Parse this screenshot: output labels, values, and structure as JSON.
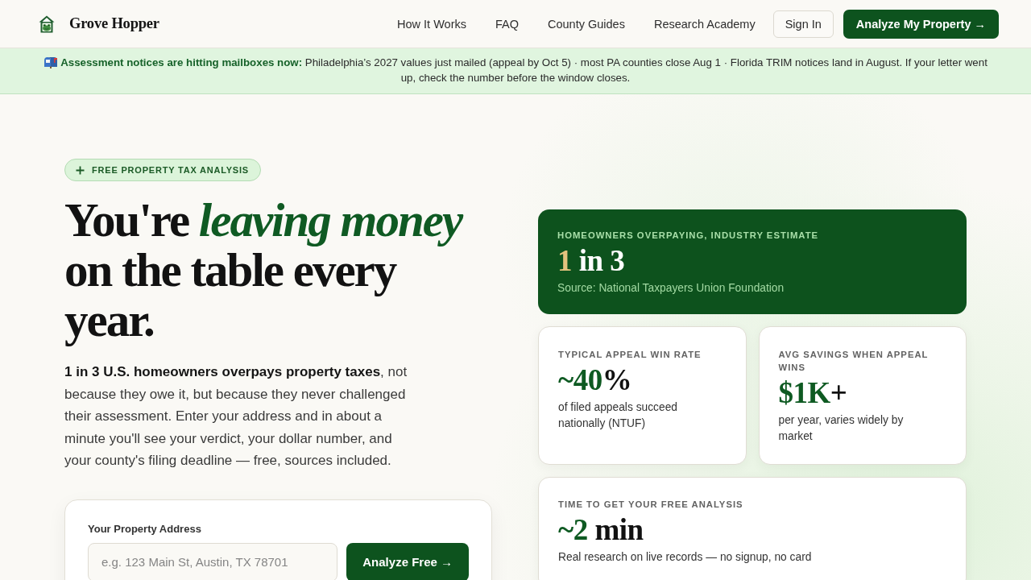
{
  "header": {
    "brand": "Grove Hopper",
    "nav": [
      "How It Works",
      "FAQ",
      "County Guides",
      "Research Academy"
    ],
    "sign_in": "Sign In",
    "cta": "Analyze My Property →"
  },
  "notice": "**Assessment notices are hitting mailboxes now:** Philadelphia’s 2027 values just mailed (appeal by Oct 5) · most PA counties close Aug 1 · Florida TRIM notices land in August. If your letter went up, check the number before the window closes.",
  "hero": {
    "badge": "FREE PROPERTY TAX ANALYSIS",
    "headline": "You're *leaving money* on the table every year.",
    "intro": "**1 in 3 U.S. homeowners overpays property taxes**, not because they owe it, but because they never challenged their assessment. Enter your address and in about a minute you'll see your verdict, your dollar number, and your county's filing deadline — free, sources included.",
    "address_form": {
      "label": "Your Property Address",
      "placeholder": "e.g. 123 Main St, Austin, TX 78701",
      "button": "Analyze Free →"
    }
  },
  "stats": [
    {
      "kind": "featured",
      "label": "HOMEOWNERS OVERPAYING, INDUSTRY ESTIMATE",
      "value": "**1** in 3",
      "note": "Source: National Taxpayers Union Foundation"
    },
    {
      "kind": "half",
      "label": "TYPICAL APPEAL WIN RATE",
      "value": "**~40**%",
      "note": "of filed appeals succeed nationally (NTUF)"
    },
    {
      "kind": "half",
      "label": "AVG SAVINGS WHEN APPEAL WINS",
      "value": "**$1K**+",
      "note": "per year, varies widely by market"
    },
    {
      "kind": "wide",
      "label": "TIME TO GET YOUR FREE ANALYSIS",
      "value": "**~2** min",
      "note": "Real research on live records — no signup, no card"
    }
  ]
}
